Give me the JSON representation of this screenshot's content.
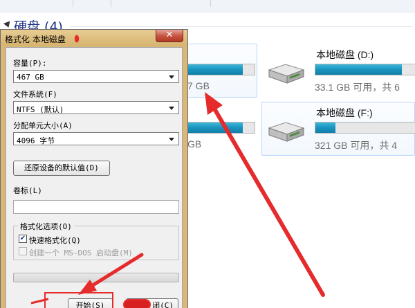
{
  "explorer": {
    "section_title": "硬盘 (4)",
    "drives": [
      {
        "name": "",
        "info_partial": "7 GB",
        "usage": 0.82
      },
      {
        "name": "本地磁盘 (D:)",
        "info": "33.1 GB 可用，共 6",
        "usage": 0.87
      },
      {
        "name": "",
        "info_partial": "GB",
        "usage": 0.82
      },
      {
        "name": "本地磁盘 (F:)",
        "info": "321 GB 可用，共 4",
        "usage": 0.2
      }
    ]
  },
  "dialog": {
    "title": "格式化 本地磁盘",
    "close_glyph": "✕",
    "capacity_label": "容量(P):",
    "capacity_value": "467 GB",
    "filesystem_label": "文件系统(F)",
    "filesystem_value": "NTFS (默认)",
    "alloc_label": "分配单元大小(A)",
    "alloc_value": "4096 字节",
    "restore_defaults_label": "还原设备的默认值(D)",
    "volume_label": "卷标(L)",
    "volume_value": "",
    "format_options_label": "格式化选项(O)",
    "quick_format_label": "快速格式化(Q)",
    "quick_format_checked": true,
    "msdos_label": "创建一个 MS-DOS 启动盘(M)",
    "msdos_checked": false,
    "start_label": "开始(S)",
    "close_label_partial": "闭(C)"
  },
  "colors": {
    "annotation_red": "#e52b2b",
    "drive_bar": "#1993be",
    "dialog_frame": "#d9b877"
  },
  "icons": [
    "hard-drive-icon",
    "close-icon",
    "dropdown-arrow-icon",
    "checkbox-icon"
  ]
}
